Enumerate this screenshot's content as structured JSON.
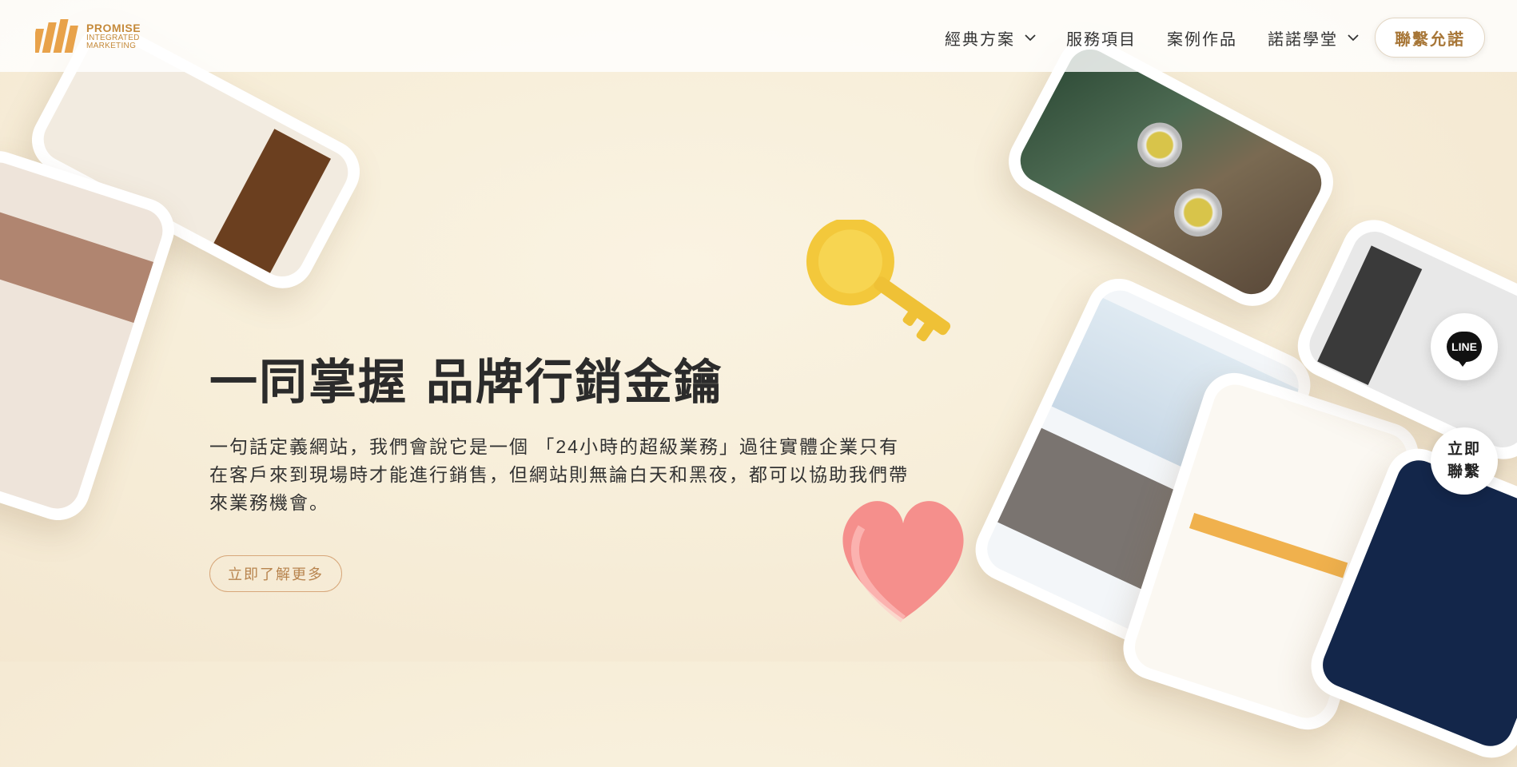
{
  "brand": {
    "name_line1": "PROMISE",
    "name_line2": "INTEGRATED",
    "name_line3": "MARKETING",
    "accent": "#c58a3a"
  },
  "nav": {
    "items": [
      {
        "label": "經典方案",
        "dropdown": true
      },
      {
        "label": "服務項目",
        "dropdown": false
      },
      {
        "label": "案例作品",
        "dropdown": false
      },
      {
        "label": "諾諾學堂",
        "dropdown": true
      }
    ],
    "contact_label": "聯繫允諾"
  },
  "hero": {
    "title": "一同掌握 品牌行銷金鑰",
    "description": "一句話定義網站，我們會說它是一個 「24小時的超級業務」過往實體企業只有在客戶來到現場時才能進行銷售，但網站則無論白天和黑夜，都可以協助我們帶來業務機會。",
    "cta_label": "立即了解更多"
  },
  "floating": {
    "line_label": "LINE",
    "contact_now_line1": "立即",
    "contact_now_line2": "聯繫"
  },
  "icons": [
    "chevron-down-icon",
    "line-chat-icon",
    "key-icon",
    "heart-icon"
  ]
}
